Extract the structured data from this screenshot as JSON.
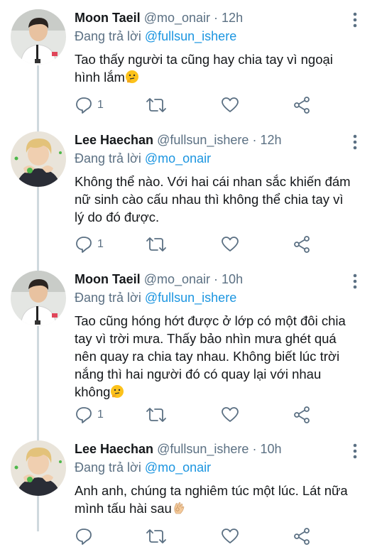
{
  "labels": {
    "replying_to": "Đang trả lời"
  },
  "colors": {
    "accent": "#1b95e0",
    "muted": "#5b7083",
    "thread_line": "#cfd9de"
  },
  "tweets": [
    {
      "name": "Moon Taeil",
      "handle": "@mo_onair",
      "separator": "·",
      "time": "12h",
      "reply_to": "@fullsun_ishere",
      "lines": [
        "Tao thấy người ta cũng hay chia tay vì ngoại",
        "hình lắm"
      ],
      "emoji": "thinking-face",
      "reply_count": "1"
    },
    {
      "name": "Lee Haechan",
      "handle": "@fullsun_ishere",
      "separator": "·",
      "time": "12h",
      "reply_to": "@mo_onair",
      "lines": [
        "Không thể nào. Với hai cái nhan sắc khiến đám",
        "nữ sinh cào cấu nhau thì không thể chia tay vì",
        "lý do đó được."
      ],
      "emoji": "",
      "reply_count": "1"
    },
    {
      "name": "Moon Taeil",
      "handle": "@mo_onair",
      "separator": "·",
      "time": "10h",
      "reply_to": "@fullsun_ishere",
      "lines": [
        "Tao cũng hóng hớt được ở lớp có một đôi chia",
        "tay vì trời mưa. Thấy bảo nhìn mưa ghét quá",
        "nên quay ra chia tay nhau. Không biết lúc trời",
        "nắng thì hai người đó có quay lại với nhau",
        "không"
      ],
      "emoji": "thinking-face",
      "reply_count": "1"
    },
    {
      "name": "Lee Haechan",
      "handle": "@fullsun_ishere",
      "separator": "·",
      "time": "10h",
      "reply_to": "@mo_onair",
      "lines": [
        "Anh anh, chúng ta nghiêm túc một lúc. Lát nữa",
        "mình tấu hài sau"
      ],
      "emoji": "ok-hand",
      "reply_count": ""
    }
  ]
}
